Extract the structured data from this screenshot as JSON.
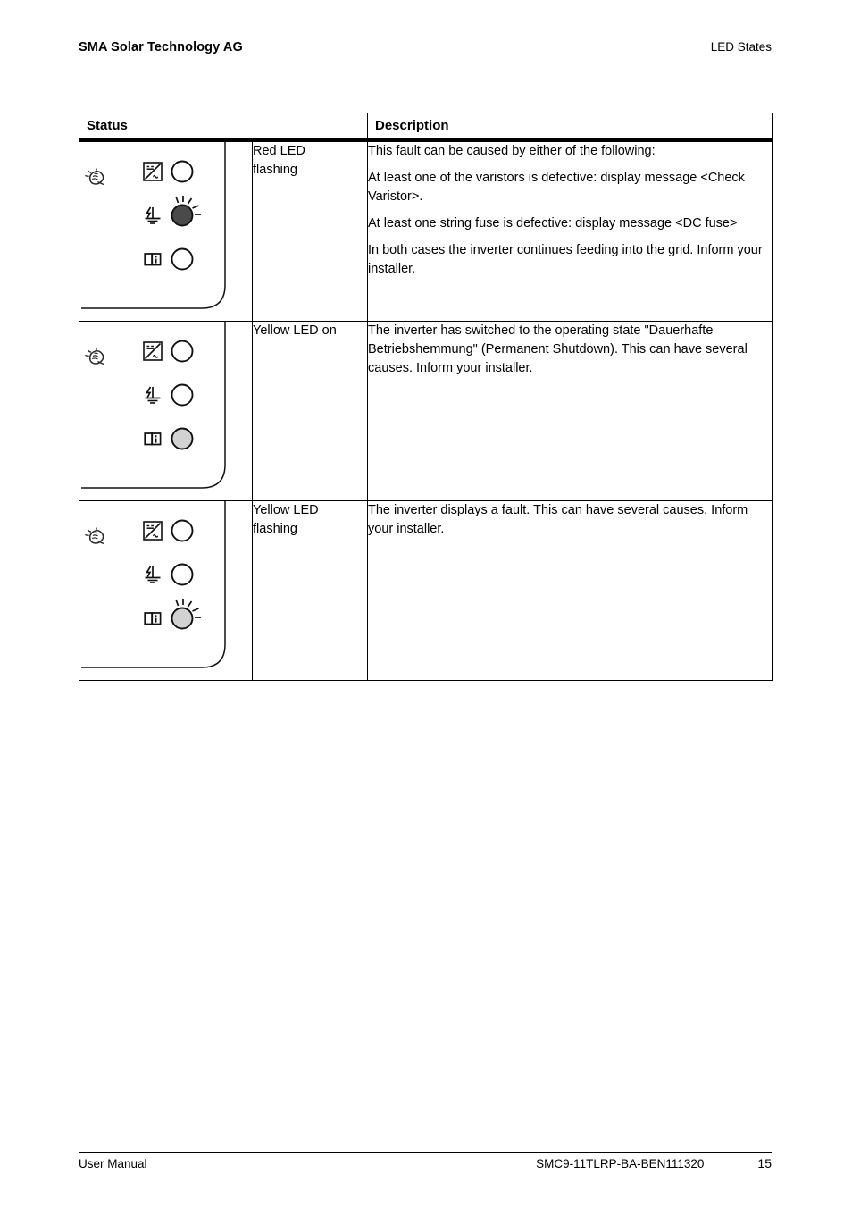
{
  "header": {
    "left": "SMA Solar Technology AG",
    "right": "LED States"
  },
  "table": {
    "columns": [
      "Status",
      "Description"
    ],
    "rows": [
      {
        "id": "red-led-flashing",
        "state_label": "Red LED\nflashing",
        "state_label_lines": [
          "Red LED",
          "flashing"
        ],
        "description_paragraphs": [
          "This fault can be caused by either of the following:",
          "At least one of the varistors is defective: display message <Check Varistor>.",
          "At least one string fuse is defective: display message <DC fuse>",
          "In both cases the inverter continues feeding into the grid. Inform your installer."
        ],
        "leds": [
          {
            "icon": "inverter-dc-ac-icon",
            "fill": "none",
            "flashing": false
          },
          {
            "icon": "ground-fault-icon",
            "fill": "#4a4a4a",
            "flashing": true
          },
          {
            "icon": "manual-info-icon",
            "fill": "none",
            "flashing": false
          }
        ]
      },
      {
        "id": "yellow-led-on",
        "state_label": "Yellow LED on",
        "state_label_lines": [
          "Yellow LED on"
        ],
        "description_paragraphs": [
          "The inverter has switched to the operating state \"Dauerhafte Betriebshemmung\" (Permanent Shutdown). This can have several causes. Inform your installer."
        ],
        "leds": [
          {
            "icon": "inverter-dc-ac-icon",
            "fill": "none",
            "flashing": false
          },
          {
            "icon": "ground-fault-icon",
            "fill": "none",
            "flashing": false
          },
          {
            "icon": "manual-info-icon",
            "fill": "#d2d2d2",
            "flashing": false
          }
        ]
      },
      {
        "id": "yellow-led-flashing",
        "state_label": "Yellow LED\nflashing",
        "state_label_lines": [
          "Yellow LED",
          "flashing"
        ],
        "description_paragraphs": [
          "The inverter displays a fault. This can have several causes. Inform your installer."
        ],
        "leds": [
          {
            "icon": "inverter-dc-ac-icon",
            "fill": "none",
            "flashing": false
          },
          {
            "icon": "ground-fault-icon",
            "fill": "none",
            "flashing": false
          },
          {
            "icon": "manual-info-icon",
            "fill": "#d2d2d2",
            "flashing": true
          }
        ]
      }
    ]
  },
  "footer": {
    "left": "User Manual",
    "center": "SMC9-11TLRP-BA-BEN111320",
    "page_number": "15"
  },
  "colors": {
    "led_off_stroke": "#1a1a1a",
    "led_red_fill": "#4a4a4a",
    "led_yellow_fill": "#d2d2d2",
    "rule": "#000000"
  }
}
